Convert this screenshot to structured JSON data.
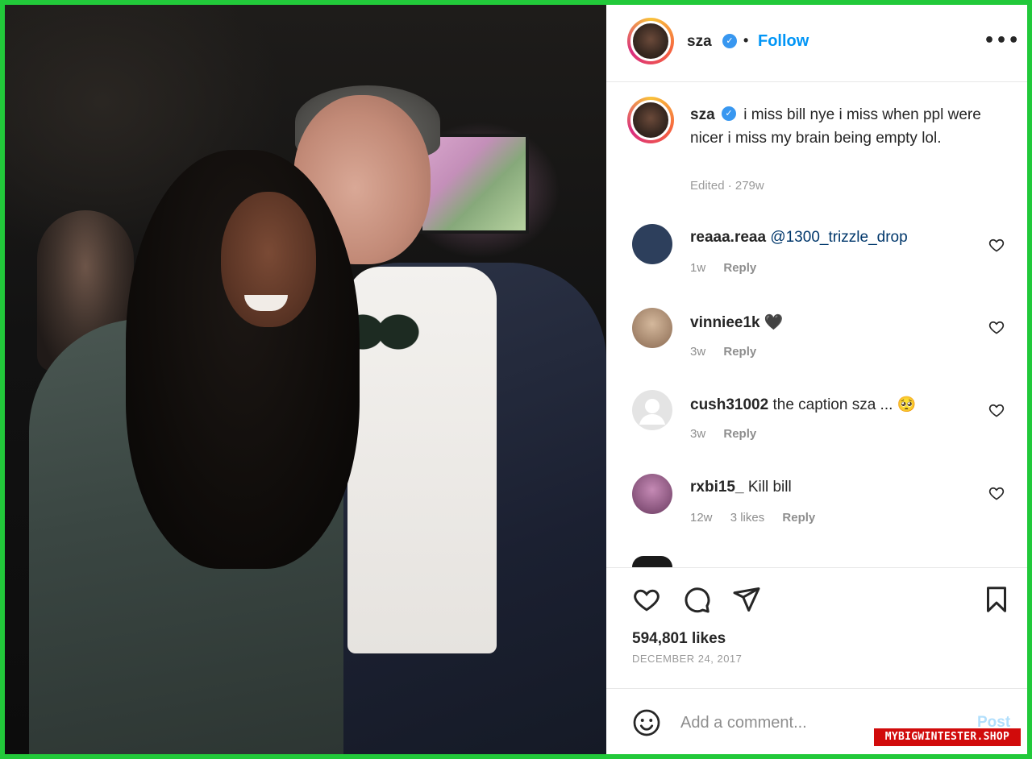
{
  "post": {
    "username": "sza",
    "verified_icon": "verified-badge-icon",
    "separator": "•",
    "follow_label": "Follow",
    "more_icon": "•••"
  },
  "caption": {
    "username": "sza",
    "text": "i miss bill nye i miss when ppl were nicer i miss my brain being empty lol.",
    "meta": "Edited · 279w"
  },
  "comments": [
    {
      "username": "reaaa.reaa",
      "text": "@1300_trizzle_drop",
      "time": "1w",
      "likes": "",
      "reply": "Reply",
      "avatar_color": "#2d3f5c"
    },
    {
      "username": "vinniee1k",
      "text": "🖤",
      "time": "3w",
      "likes": "",
      "reply": "Reply",
      "avatar_color": "#a98e74"
    },
    {
      "username": "cush31002",
      "text": "the caption sza ... 🥺",
      "time": "3w",
      "likes": "",
      "reply": "Reply",
      "avatar_color": "#dcdcdc"
    },
    {
      "username": "rxbi15_",
      "text": "Kill bill",
      "time": "12w",
      "likes": "3 likes",
      "reply": "Reply",
      "avatar_color": "#8b4a7c"
    }
  ],
  "actions": {
    "like_icon": "heart-icon",
    "comment_icon": "comment-bubble-icon",
    "share_icon": "paper-plane-icon",
    "save_icon": "bookmark-icon"
  },
  "stats": {
    "likes": "594,801 likes",
    "date": "DECEMBER 24, 2017"
  },
  "add_comment": {
    "emoji_icon": "smiley-icon",
    "placeholder": "Add a comment...",
    "post_label": "Post"
  },
  "watermark": "MYBIGWINTESTER.SHOP",
  "colors": {
    "border_green": "#22c93a",
    "follow_blue": "#0095f6",
    "verified_blue": "#3897f0",
    "watermark_red": "#d10b0b"
  }
}
